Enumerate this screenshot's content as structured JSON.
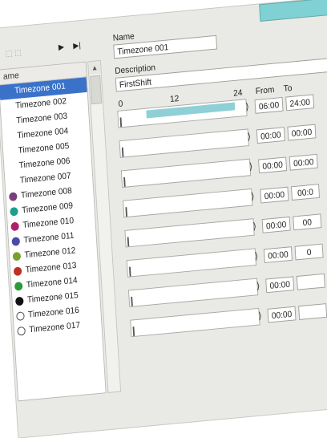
{
  "toolbar": {
    "play_icon": "play-icon",
    "next_icon": "skip-next-icon"
  },
  "list": {
    "header": "ame",
    "items": [
      {
        "label": "Timezone 001",
        "color": "",
        "selected": true
      },
      {
        "label": "Timezone 002",
        "color": ""
      },
      {
        "label": "Timezone 003",
        "color": ""
      },
      {
        "label": "Timezone 004",
        "color": ""
      },
      {
        "label": "Timezone 005",
        "color": ""
      },
      {
        "label": "Timezone 006",
        "color": ""
      },
      {
        "label": "Timezone 007",
        "color": ""
      },
      {
        "label": "Timezone 008",
        "color": "#7a3f7a"
      },
      {
        "label": "Timezone 009",
        "color": "#1a9f8a"
      },
      {
        "label": "Timezone 010",
        "color": "#b0206a"
      },
      {
        "label": "Timezone 011",
        "color": "#4a4aa8"
      },
      {
        "label": "Timezone 012",
        "color": "#7aa030"
      },
      {
        "label": "Timezone 013",
        "color": "#c03020"
      },
      {
        "label": "Timezone 014",
        "color": "#2a9a3a"
      },
      {
        "label": "Timezone 015",
        "color": "#111111"
      },
      {
        "label": "Timezone 016",
        "color": "#ffffff"
      },
      {
        "label": "Timezone 017",
        "color": "#ffffff"
      }
    ]
  },
  "form": {
    "name_label": "Name",
    "name_value": "Timezone 001",
    "description_label": "Description",
    "description_value": "FirstShift",
    "scale": {
      "start": "0",
      "mid": "12",
      "end": "24"
    },
    "from_label": "From",
    "to_label": "To"
  },
  "ranges": [
    {
      "from": "06:00",
      "to": "24:00",
      "active": true
    },
    {
      "from": "00:00",
      "to": "00:00"
    },
    {
      "from": "00:00",
      "to": "00:00"
    },
    {
      "from": "00:00",
      "to": "00:0"
    },
    {
      "from": "00:00",
      "to": "00"
    },
    {
      "from": "00:00",
      "to": "0"
    },
    {
      "from": "00:00",
      "to": ""
    },
    {
      "from": "00:00",
      "to": ""
    }
  ],
  "colors": {
    "selection": "#3a72c9",
    "accent": "#8fd0d6"
  }
}
